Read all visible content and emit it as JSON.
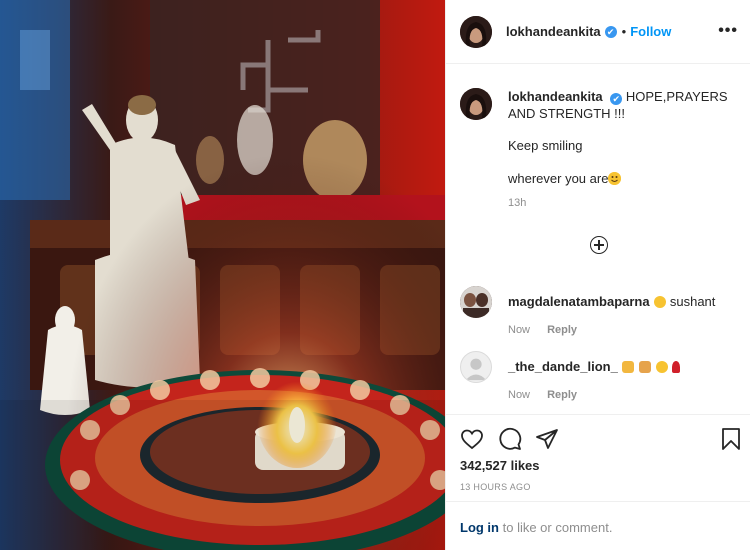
{
  "post": {
    "photo_description": "",
    "author": {
      "username": "lokhandeankita",
      "verified_mark": "✔",
      "follow_separator": "•",
      "follow_label": "Follow",
      "more_icon": "more-options-icon"
    },
    "caption": {
      "username": "lokhandeankita",
      "line1": "HOPE,PRAYERS AND STRENGTH !!!",
      "line2": "Keep smiling",
      "line3": "wherever you are",
      "time": "13h"
    },
    "load_more_icon": "plus-circle-icon",
    "comments": [
      {
        "username": "magdalenatambaparna",
        "text": "sushant",
        "time": "Now",
        "reply_label": "Reply"
      },
      {
        "username": "_the_dande_lion_",
        "text": "",
        "time": "Now",
        "reply_label": "Reply"
      }
    ],
    "actions": {
      "likes": "342,527 likes",
      "timestamp": "13 HOURS AGO"
    },
    "login": {
      "link": "Log in",
      "rest": " to like or comment."
    }
  },
  "colors": {
    "accent_blue": "#0095f6",
    "verified_blue": "#3897f0",
    "secondary_text": "#8e8e8e",
    "border": "#efefef"
  }
}
